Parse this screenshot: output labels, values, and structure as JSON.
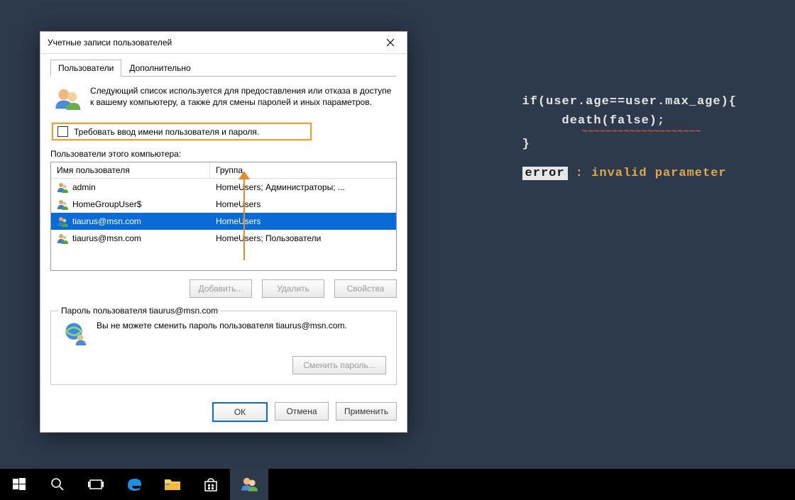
{
  "desktop": {
    "code_line1": "if(user.age==user.max_age){",
    "code_line2": "death(false);",
    "code_line3": "}",
    "error_label": "error",
    "error_rest": " : invalid parameter"
  },
  "dialog": {
    "title": "Учетные записи пользователей",
    "tabs": {
      "users": "Пользователи",
      "advanced": "Дополнительно"
    },
    "intro": "Следующий список используется для предоставления или отказа в доступе к вашему компьютеру, а также для смены паролей и иных параметров.",
    "require_checkbox_label": "Требовать ввод имени пользователя и пароля.",
    "list_label": "Пользователи этого компьютера:",
    "columns": {
      "name": "Имя пользователя",
      "group": "Группа"
    },
    "rows": [
      {
        "name": "admin",
        "group": "HomeUsers; Администраторы; ..."
      },
      {
        "name": "HomeGroupUser$",
        "group": "HomeUsers"
      },
      {
        "name": "tiaurus@msn.com",
        "group": "HomeUsers"
      },
      {
        "name": "tiaurus@msn.com",
        "group": "HomeUsers; Пользователи"
      }
    ],
    "selected_index": 2,
    "buttons": {
      "add": "Добавить...",
      "delete": "Удалить",
      "props": "Свойства",
      "change_pwd": "Сменить пароль...",
      "ok": "ОК",
      "cancel": "Отмена",
      "apply": "Применить"
    },
    "password_group_title": "Пароль пользователя tiaurus@msn.com",
    "password_msg": "Вы не можете сменить пароль пользователя tiaurus@msn.com."
  }
}
